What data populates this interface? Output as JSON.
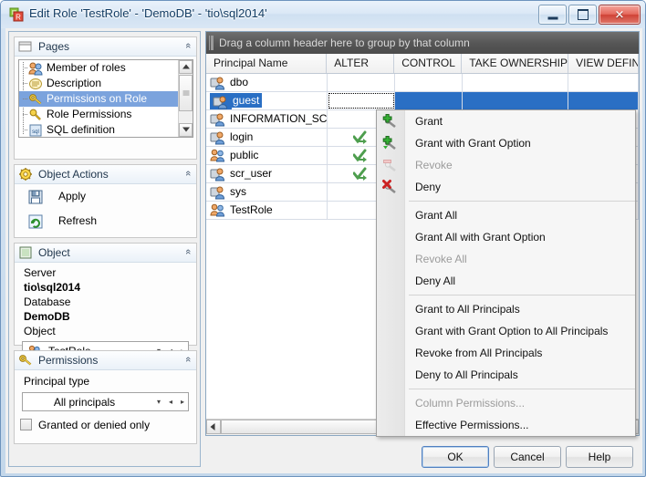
{
  "window": {
    "title": "Edit Role 'TestRole' - 'DemoDB' - 'tio\\sql2014'",
    "icon": "role-editor-icon",
    "minimize_label": "Minimize",
    "maximize_label": "Maximize",
    "close_label": "Close",
    "close_glyph": "✕"
  },
  "sidebar": {
    "pages": {
      "title": "Pages",
      "icon": "pages-folder-icon",
      "collapse_glyph": "«",
      "items": [
        {
          "label": "Member of roles",
          "icon": "users-group-icon",
          "selected": false
        },
        {
          "label": "Description",
          "icon": "description-icon",
          "selected": false
        },
        {
          "label": "Permissions on Role",
          "icon": "key-gold-icon",
          "selected": true
        },
        {
          "label": "Role Permissions",
          "icon": "key-magnifier-icon",
          "selected": false
        },
        {
          "label": "SQL definition",
          "icon": "sql-script-icon",
          "selected": false
        }
      ]
    },
    "object_actions": {
      "title": "Object Actions",
      "icon": "gear-icon",
      "collapse_glyph": "«",
      "items": [
        {
          "label": "Apply",
          "icon": "save-disk-icon"
        },
        {
          "label": "Refresh",
          "icon": "refresh-icon"
        }
      ]
    },
    "object": {
      "title": "Object",
      "icon": "object-icon",
      "collapse_glyph": "«",
      "server_label": "Server",
      "server_value": "tio\\sql2014",
      "database_label": "Database",
      "database_value": "DemoDB",
      "object_label": "Object",
      "object_value": "TestRole",
      "object_icon": "role-icon",
      "dropdown_glyph": "▾",
      "prev_glyph": "◂",
      "next_glyph": "▸"
    },
    "permissions": {
      "title": "Permissions",
      "icon": "key-gold-icon",
      "collapse_glyph": "«",
      "principal_type_label": "Principal type",
      "principal_type_value": "All principals",
      "dropdown_glyph": "▾",
      "prev_glyph": "◂",
      "next_glyph": "▸",
      "granted_only_label": "Granted or denied only",
      "granted_only_checked": false
    }
  },
  "grid": {
    "group_panel_text": "Drag a column header here to group by that column",
    "columns": [
      "Principal Name",
      "ALTER",
      "CONTROL",
      "TAKE OWNERSHIP",
      "VIEW DEFINI"
    ],
    "rows": [
      {
        "name": "dbo",
        "icon": "user-icon",
        "selected": false,
        "alter": "",
        "control": "",
        "take_ownership": "",
        "view_definition": ""
      },
      {
        "name": "guest",
        "icon": "user-icon",
        "selected": true,
        "alter": "",
        "control": "",
        "take_ownership": "",
        "view_definition": ""
      },
      {
        "name": "INFORMATION_SCHEM",
        "icon": "user-icon",
        "selected": false,
        "alter": "",
        "control": "",
        "take_ownership": "",
        "view_definition": ""
      },
      {
        "name": "login",
        "icon": "user-icon",
        "selected": false,
        "alter": "grant",
        "control": "",
        "take_ownership": "",
        "view_definition": ""
      },
      {
        "name": "public",
        "icon": "role-icon",
        "selected": false,
        "alter": "grant",
        "control": "",
        "take_ownership": "",
        "view_definition": ""
      },
      {
        "name": "scr_user",
        "icon": "user-icon",
        "selected": false,
        "alter": "grant",
        "control": "",
        "take_ownership": "",
        "view_definition": ""
      },
      {
        "name": "sys",
        "icon": "user-icon",
        "selected": false,
        "alter": "",
        "control": "",
        "take_ownership": "",
        "view_definition": ""
      },
      {
        "name": "TestRole",
        "icon": "role-icon",
        "selected": false,
        "alter": "",
        "control": "",
        "take_ownership": "",
        "view_definition": ""
      }
    ]
  },
  "context_menu": {
    "items": [
      {
        "label": "Grant",
        "icon": "grant-key-icon",
        "enabled": true,
        "separator_after": false
      },
      {
        "label": "Grant with Grant Option",
        "icon": "grant-option-icon",
        "enabled": true,
        "separator_after": false
      },
      {
        "label": "Revoke",
        "icon": "revoke-key-icon",
        "enabled": false,
        "separator_after": false
      },
      {
        "label": "Deny",
        "icon": "deny-key-icon",
        "enabled": true,
        "separator_after": true
      },
      {
        "label": "Grant All",
        "icon": "",
        "enabled": true,
        "separator_after": false
      },
      {
        "label": "Grant All with Grant Option",
        "icon": "",
        "enabled": true,
        "separator_after": false
      },
      {
        "label": "Revoke All",
        "icon": "",
        "enabled": false,
        "separator_after": false
      },
      {
        "label": "Deny All",
        "icon": "",
        "enabled": true,
        "separator_after": true
      },
      {
        "label": "Grant to All Principals",
        "icon": "",
        "enabled": true,
        "separator_after": false
      },
      {
        "label": "Grant with Grant Option to All Principals",
        "icon": "",
        "enabled": true,
        "separator_after": false
      },
      {
        "label": "Revoke from All Principals",
        "icon": "",
        "enabled": true,
        "separator_after": false
      },
      {
        "label": "Deny to All Principals",
        "icon": "",
        "enabled": true,
        "separator_after": true
      },
      {
        "label": "Column Permissions...",
        "icon": "",
        "enabled": false,
        "separator_after": false
      },
      {
        "label": "Effective Permissions...",
        "icon": "",
        "enabled": true,
        "separator_after": false
      }
    ]
  },
  "footer": {
    "ok_label": "OK",
    "cancel_label": "Cancel",
    "help_label": "Help"
  },
  "colors": {
    "selection_blue": "#2a6fc4",
    "tree_selection": "#7ba3dd",
    "group_panel": "#555555",
    "grant_green": "#3f9a3f",
    "deny_red": "#cc2222"
  }
}
